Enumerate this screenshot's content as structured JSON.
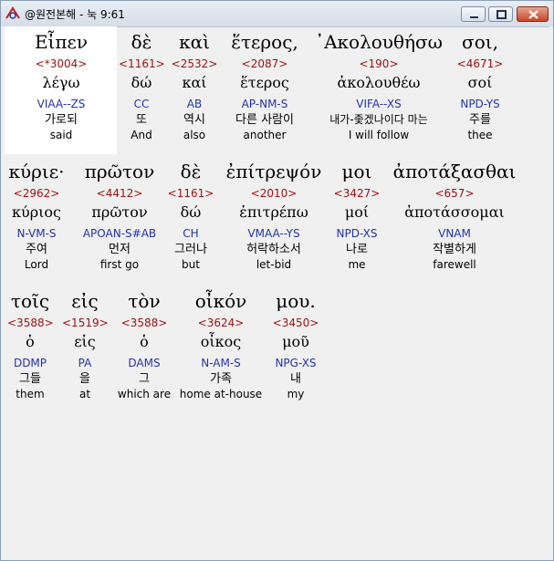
{
  "window": {
    "title": "@원전본해 - 눅 9:61",
    "icon": "app-logo-icon",
    "controls": [
      "minimize-icon",
      "maximize-icon",
      "close-icon"
    ]
  },
  "colors": {
    "strong_number": "#a01010",
    "parsing": "#2233aa",
    "text": "#000000"
  },
  "rows": [
    {
      "words": [
        {
          "greek": "Εἶπεν",
          "num": "<*3004>",
          "lemma": "λέγω",
          "parse": "VIAA--ZS",
          "kor": "가로되",
          "eng": "said"
        },
        {
          "greek": "δὲ",
          "num": "<1161>",
          "lemma": "δώ",
          "parse": "CC",
          "kor": "또",
          "eng": "And"
        },
        {
          "greek": "καὶ",
          "num": "<2532>",
          "lemma": "καί",
          "parse": "AB",
          "kor": "역시",
          "eng": "also"
        },
        {
          "greek": "ἕτερος,",
          "num": "<2087>",
          "lemma": "ἕτερος",
          "parse": "AP-NM-S",
          "kor": "다른 사람이",
          "eng": "another"
        },
        {
          "greek": "᾽Ακολουθήσω",
          "num": "<190>",
          "lemma": "ἀκολουθέω",
          "parse": "VIFA--XS",
          "kor": "내가-좇겠나이다 마는",
          "eng": "I will follow"
        },
        {
          "greek": "σοι,",
          "num": "<4671>",
          "lemma": "σοί",
          "parse": "NPD-YS",
          "kor": "주를",
          "eng": "thee"
        }
      ]
    },
    {
      "words": [
        {
          "greek": "κύριε·",
          "num": "<2962>",
          "lemma": "κύριος",
          "parse": "N-VM-S",
          "kor": "주여",
          "eng": "Lord"
        },
        {
          "greek": "πρῶτον",
          "num": "<4412>",
          "lemma": "πρῶτον",
          "parse": "APOAN-S#AB",
          "kor": "먼저",
          "eng": "first go"
        },
        {
          "greek": "δὲ",
          "num": "<1161>",
          "lemma": "δώ",
          "parse": "CH",
          "kor": "그러나",
          "eng": "but"
        },
        {
          "greek": "ἐπίτρεψόν",
          "num": "<2010>",
          "lemma": "ἐπιτρέπω",
          "parse": "VMAA--YS",
          "kor": "허락하소서",
          "eng": "let-bid"
        },
        {
          "greek": "μοι",
          "num": "<3427>",
          "lemma": "μοί",
          "parse": "NPD-XS",
          "kor": "나로",
          "eng": "me"
        },
        {
          "greek": "ἀποτάξασθαι",
          "num": "<657>",
          "lemma": "ἀποτάσσομαι",
          "parse": "VNAM",
          "kor": "작별하게",
          "eng": "farewell"
        }
      ]
    },
    {
      "words": [
        {
          "greek": "τοῖς",
          "num": "<3588>",
          "lemma": "ὁ",
          "parse": "DDMP",
          "kor": "그들",
          "eng": "them"
        },
        {
          "greek": "εἰς",
          "num": "<1519>",
          "lemma": "εἰς",
          "parse": "PA",
          "kor": "을",
          "eng": "at"
        },
        {
          "greek": "τὸν",
          "num": "<3588>",
          "lemma": "ὁ",
          "parse": "DAMS",
          "kor": "그",
          "eng": "which are"
        },
        {
          "greek": "οἶκόν",
          "num": "<3624>",
          "lemma": "οἶκος",
          "parse": "N-AM-S",
          "kor": "가족",
          "eng": "home at-house"
        },
        {
          "greek": "μου.",
          "num": "<3450>",
          "lemma": "μοῦ",
          "parse": "NPG-XS",
          "kor": "내",
          "eng": "my"
        }
      ]
    }
  ]
}
